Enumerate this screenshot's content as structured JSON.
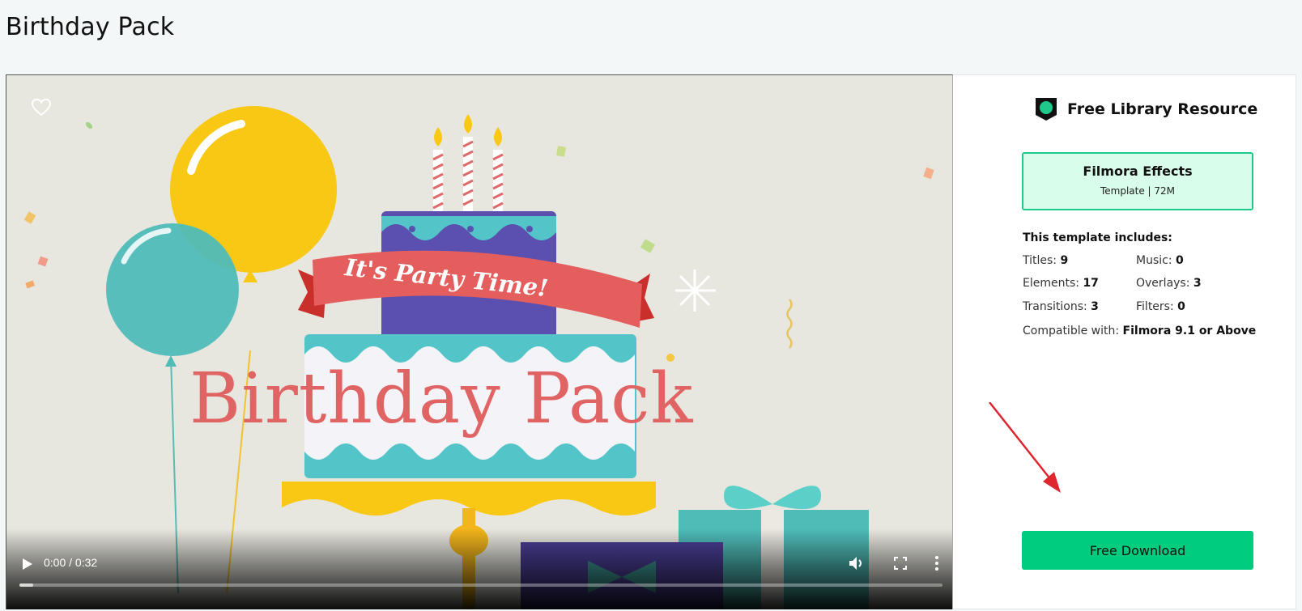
{
  "page": {
    "title": "Birthday Pack"
  },
  "video": {
    "poster_banner_text": "It's Party Time!",
    "poster_title_text": "Birthday Pack",
    "favorite_icon": "heart-outline-icon",
    "controls": {
      "play_icon": "play-icon",
      "current_time": "0:00",
      "duration": "0:32",
      "time_display": "0:00 / 0:32",
      "volume_icon": "volume-icon",
      "fullscreen_icon": "fullscreen-icon",
      "more_icon": "more-vertical-icon",
      "progress_fraction": 0.015
    }
  },
  "sidebar": {
    "resource_icon": "shield-badge-icon",
    "resource_title": "Free Library Resource",
    "product": {
      "name": "Filmora Effects",
      "meta": "Template | 72M"
    },
    "includes_heading": "This template includes:",
    "stats": [
      {
        "label": "Titles:",
        "value": "9"
      },
      {
        "label": "Music:",
        "value": "0"
      },
      {
        "label": "Elements:",
        "value": "17"
      },
      {
        "label": "Overlays:",
        "value": "3"
      },
      {
        "label": "Transitions:",
        "value": "3"
      },
      {
        "label": "Filters:",
        "value": "0"
      }
    ],
    "compatible_label": "Compatible with:",
    "compatible_value": "Filmora 9.1 or Above",
    "annotation_icon": "red-arrow-icon",
    "download_label": "Free Download"
  },
  "colors": {
    "accent_green": "#00cc7e",
    "product_box_bg": "#d8fdea",
    "product_box_border": "#1ec98a",
    "annotation_arrow": "#e0262e",
    "page_bg": "#f4f7f7"
  }
}
